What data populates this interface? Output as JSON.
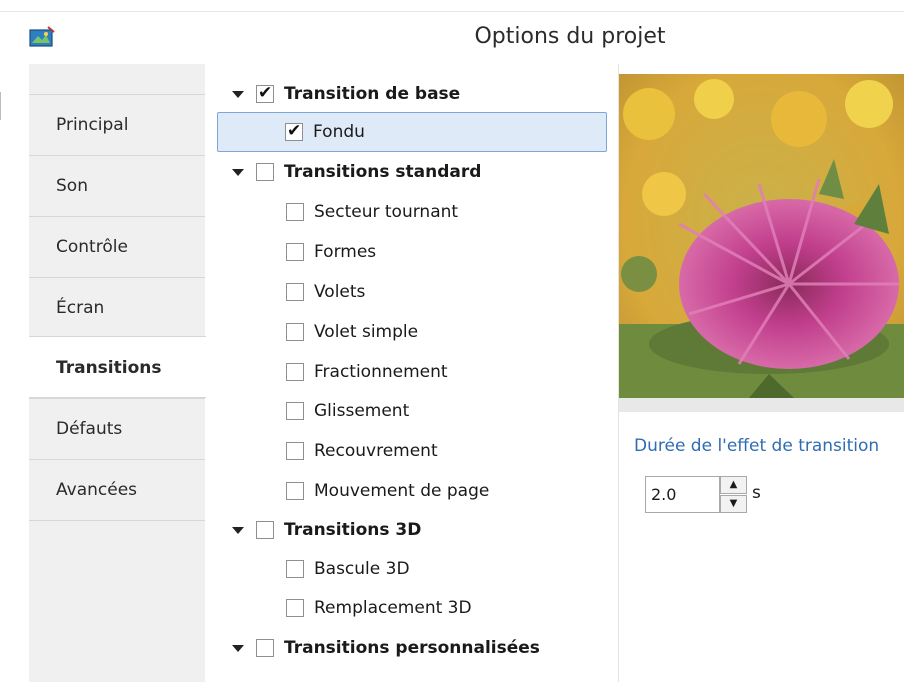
{
  "window": {
    "title": "Options du projet",
    "icon": "app-icon"
  },
  "tabs": [
    {
      "label": "Principal",
      "active": false
    },
    {
      "label": "Son",
      "active": false
    },
    {
      "label": "Contrôle",
      "active": false
    },
    {
      "label": "Écran",
      "active": false
    },
    {
      "label": "Transitions",
      "active": true
    },
    {
      "label": "Défauts",
      "active": false
    },
    {
      "label": "Avancées",
      "active": false
    }
  ],
  "tree": {
    "groups": [
      {
        "label": "Transition de base",
        "checked": true,
        "expanded": true,
        "items": [
          {
            "label": "Fondu",
            "checked": true,
            "selected": true
          }
        ]
      },
      {
        "label": "Transitions standard",
        "checked": false,
        "expanded": true,
        "items": [
          {
            "label": "Secteur tournant",
            "checked": false
          },
          {
            "label": "Formes",
            "checked": false
          },
          {
            "label": "Volets",
            "checked": false
          },
          {
            "label": "Volet simple",
            "checked": false
          },
          {
            "label": "Fractionnement",
            "checked": false
          },
          {
            "label": "Glissement",
            "checked": false
          },
          {
            "label": "Recouvrement",
            "checked": false
          },
          {
            "label": "Mouvement de page",
            "checked": false
          }
        ]
      },
      {
        "label": "Transitions 3D",
        "checked": false,
        "expanded": true,
        "items": [
          {
            "label": "Bascule 3D",
            "checked": false
          },
          {
            "label": "Remplacement 3D",
            "checked": false
          }
        ]
      },
      {
        "label": "Transitions personnalisées",
        "checked": false,
        "expanded": true,
        "items": []
      }
    ]
  },
  "effect": {
    "duration_label": "Durée de l'effet de transition",
    "duration_value": "2.0",
    "unit": "s"
  },
  "colors": {
    "accent_text": "#2f6db3",
    "selection_bg": "#dfeaf8",
    "selection_border": "#7fa7d6",
    "tab_bg": "#f0f0f0"
  }
}
